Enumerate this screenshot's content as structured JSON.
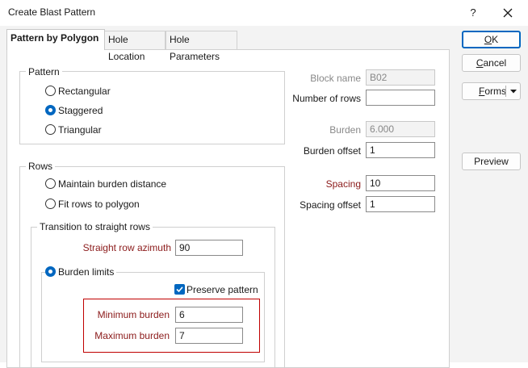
{
  "window": {
    "title": "Create Blast Pattern",
    "help_glyph": "?",
    "close_icon": "close-icon"
  },
  "tabs": [
    {
      "label": "Pattern by Polygon",
      "active": true
    },
    {
      "label": "Hole Location",
      "active": false
    },
    {
      "label": "Hole Parameters",
      "active": false
    }
  ],
  "pattern": {
    "group_label": "Pattern",
    "options": [
      {
        "label": "Rectangular",
        "selected": false
      },
      {
        "label": "Staggered",
        "selected": true
      },
      {
        "label": "Triangular",
        "selected": false
      }
    ]
  },
  "rows": {
    "group_label": "Rows",
    "options": [
      {
        "label": "Maintain burden distance",
        "selected": false
      },
      {
        "label": "Fit rows to polygon",
        "selected": false
      }
    ],
    "transition": {
      "group_label": "Transition to straight rows",
      "straight_row_azimuth_label": "Straight row azimuth",
      "straight_row_azimuth_value": "90",
      "burden_limits_label": "Burden limits",
      "burden_limits_selected": true,
      "preserve_pattern_label": "Preserve pattern",
      "preserve_pattern_checked": true,
      "minimum_burden_label": "Minimum burden",
      "minimum_burden_value": "6",
      "maximum_burden_label": "Maximum burden",
      "maximum_burden_value": "7"
    }
  },
  "right_fields": {
    "block_name_label": "Block name",
    "block_name_value": "B02",
    "number_of_rows_label": "Number of rows",
    "number_of_rows_value": "",
    "burden_label": "Burden",
    "burden_value": "6.000",
    "burden_offset_label": "Burden offset",
    "burden_offset_value": "1",
    "spacing_label": "Spacing",
    "spacing_value": "10",
    "spacing_offset_label": "Spacing offset",
    "spacing_offset_value": "1"
  },
  "buttons": {
    "ok_accel": "O",
    "ok_rest": "K",
    "cancel_accel": "C",
    "cancel_rest": "ancel",
    "forms_prefix": "",
    "forms_accel": "F",
    "forms_rest": "orms",
    "preview": "Preview"
  },
  "colors": {
    "accent": "#0067c0",
    "required_label": "#8b1a1a",
    "highlight_box": "#c00000"
  }
}
